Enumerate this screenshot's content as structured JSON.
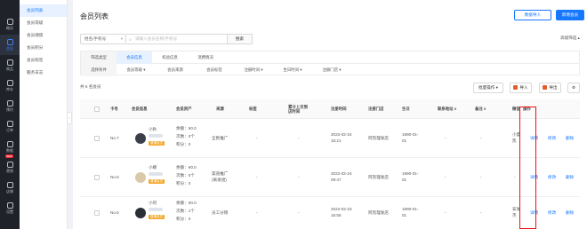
{
  "rail": [
    {
      "label": "概况",
      "icon": "chart-icon"
    },
    {
      "label": "会员",
      "icon": "user-icon",
      "active": true
    },
    {
      "label": "商品",
      "icon": "box-icon"
    },
    {
      "label": "库存",
      "icon": "stock-icon"
    },
    {
      "label": "预约",
      "icon": "calendar-icon"
    },
    {
      "label": "订单",
      "icon": "order-icon"
    },
    {
      "label": "数据",
      "icon": "data-icon"
    },
    {
      "label": "营销",
      "icon": "marketing-icon",
      "badge": "NEW"
    },
    {
      "label": "店铺",
      "icon": "store-icon"
    },
    {
      "label": "设置",
      "icon": "gear-icon"
    }
  ],
  "subnav": [
    "会员列表",
    "会员等级",
    "会员储值",
    "会员积分",
    "会员标签",
    "服务日志"
  ],
  "page": {
    "title": "会员列表",
    "import_button": "数据导入",
    "new_button": "新增会员"
  },
  "search": {
    "select_label": "姓名/手机号",
    "placeholder": "请输入会员名称/手机号",
    "button": "搜索",
    "advanced": "高级筛选"
  },
  "filter": {
    "row1_label": "筛选类型",
    "row1_items": [
      "会员信息",
      "权益信息",
      "消费情况"
    ],
    "row2_label": "选择条件",
    "row2_items": [
      "会员等级",
      "会员来源",
      "会员标签",
      "注册时间",
      "生日时间",
      "注册门店"
    ]
  },
  "toolbar": {
    "count": "共 6 名会员",
    "batch": "批量操作",
    "import": "导入",
    "export": "导出"
  },
  "columns": [
    "卡号",
    "会员信息",
    "会员资产",
    "来源",
    "标签",
    "累计上次到店时间",
    "注册时间",
    "注册门店",
    "生日",
    "联系地址",
    "备注",
    "微信",
    "操作"
  ],
  "rows": [
    {
      "card": "No.7",
      "name": "小秋",
      "level": "普通会员",
      "balance": "余额：¥0.0",
      "times": "次数：0个",
      "points": "积分：0",
      "source": "全民推广",
      "tag": "-",
      "last_visit": "-",
      "reg_date": "2022-02-24",
      "reg_time": "15:21",
      "store": "阿凯理发店",
      "birth_date": "1990-01-",
      "birth_day": "01",
      "address": "-",
      "remark": "-",
      "wechat": "小夏",
      "wechat2": "凯",
      "detail": "详情",
      "edit": "修改",
      "delete": "删除"
    },
    {
      "card": "No.6",
      "name": "小娜",
      "level": "普通会员",
      "balance": "余额：¥0.0",
      "times": "次数：0个",
      "points": "积分：0",
      "source": "渠道推广",
      "source2": "(离发组)",
      "tag": "-",
      "last_visit": "-",
      "reg_date": "2022-02-24",
      "reg_time": "09:47",
      "store": "阿凯理发店",
      "birth_date": "1990-01-",
      "birth_day": "01",
      "address": "-",
      "remark": "-",
      "wechat": "-",
      "wechat2": "",
      "detail": "详情",
      "edit": "修改",
      "delete": "删除"
    },
    {
      "card": "No.5",
      "name": "小何",
      "level": "普通会员",
      "balance": "余额：¥0.0",
      "times": "次数：1个",
      "points": "积分：0",
      "source": "员工分销",
      "tag": "-",
      "last_visit": "-",
      "reg_date": "2022-02-23",
      "reg_time": "15:55",
      "store": "阿凯理发店",
      "birth_date": "1990-01-",
      "birth_day": "01",
      "address": "-",
      "remark": "-",
      "wechat": "安发",
      "wechat2": "杰",
      "detail": "详情",
      "edit": "修改",
      "delete": "删除"
    }
  ],
  "colors": {
    "brand": "#1677ff",
    "highlight": "#e11111",
    "rail": "#1f2229"
  }
}
